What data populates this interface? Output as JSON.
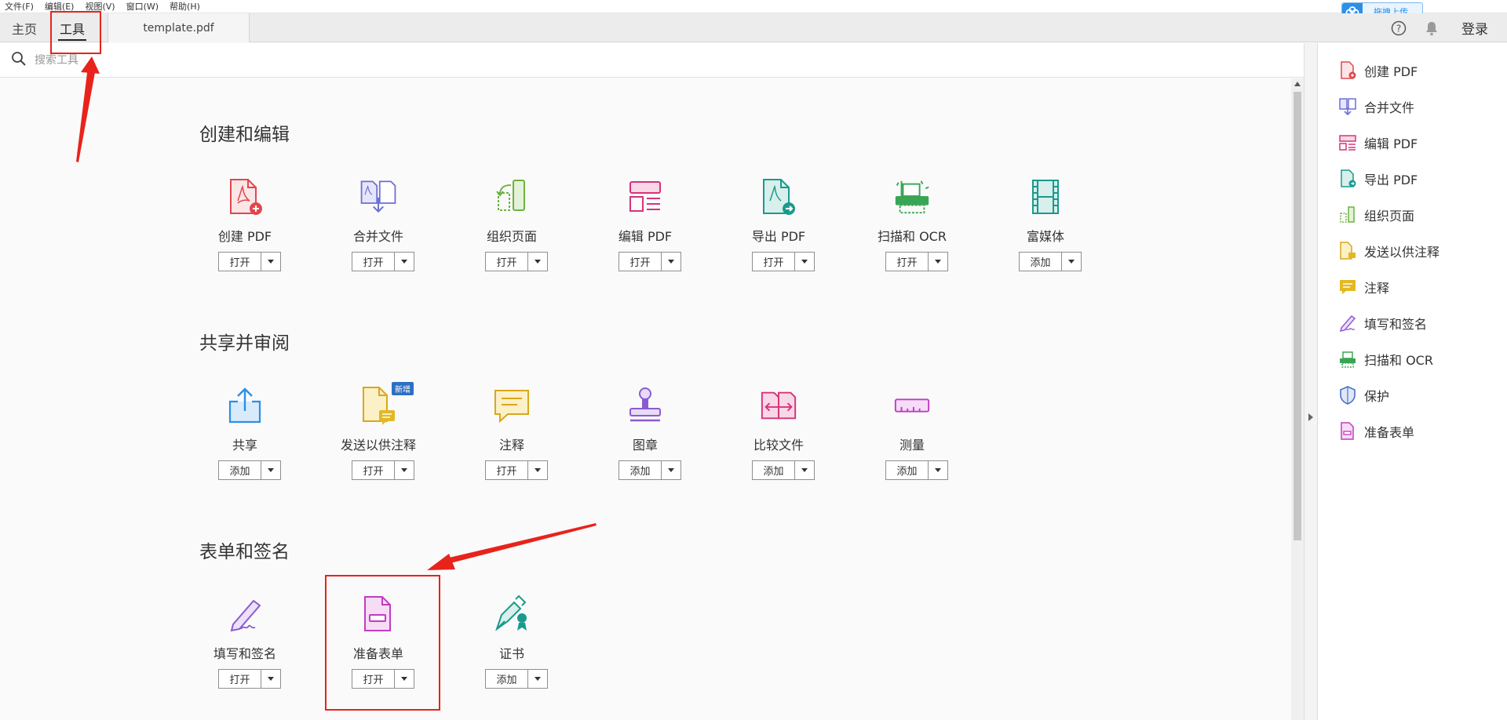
{
  "menu": [
    "文件(F)",
    "编辑(E)",
    "视图(V)",
    "窗口(W)",
    "帮助(H)"
  ],
  "tabs": {
    "home": "主页",
    "tools": "工具",
    "document": "template.pdf"
  },
  "topbar": {
    "login": "登录",
    "upload": "拖拽上传"
  },
  "search": {
    "placeholder": "搜索工具"
  },
  "sections": [
    {
      "title": "创建和编辑"
    },
    {
      "title": "共享并审阅"
    },
    {
      "title": "表单和签名"
    }
  ],
  "tools": {
    "create_pdf": {
      "name": "创建 PDF",
      "button": "打开"
    },
    "combine": {
      "name": "合并文件",
      "button": "打开"
    },
    "organize": {
      "name": "组织页面",
      "button": "打开"
    },
    "edit_pdf": {
      "name": "编辑 PDF",
      "button": "打开"
    },
    "export_pdf": {
      "name": "导出 PDF",
      "button": "打开"
    },
    "scan_ocr": {
      "name": "扫描和 OCR",
      "button": "打开"
    },
    "rich_media": {
      "name": "富媒体",
      "button": "添加"
    },
    "share": {
      "name": "共享",
      "button": "添加"
    },
    "send_comment": {
      "name": "发送以供注释",
      "button": "打开",
      "badge": "新增"
    },
    "comment": {
      "name": "注释",
      "button": "打开"
    },
    "stamp": {
      "name": "图章",
      "button": "添加"
    },
    "compare": {
      "name": "比较文件",
      "button": "添加"
    },
    "measure": {
      "name": "测量",
      "button": "添加"
    },
    "fill_sign": {
      "name": "填写和签名",
      "button": "打开"
    },
    "prepare_form": {
      "name": "准备表单",
      "button": "打开"
    },
    "certificates": {
      "name": "证书",
      "button": "添加"
    }
  },
  "right_panel": [
    "创建 PDF",
    "合并文件",
    "编辑 PDF",
    "导出 PDF",
    "组织页面",
    "发送以供注释",
    "注释",
    "填写和签名",
    "扫描和 OCR",
    "保护",
    "准备表单"
  ],
  "colors": {
    "red": "#e0474c",
    "blue_purple": "#6c6fd6",
    "green": "#6cb33f",
    "pink": "#d6337a",
    "teal": "#1a9a8c",
    "yellow": "#e3b823",
    "blue": "#2b8fe6",
    "purple": "#8b5bd1",
    "magenta": "#c03cc4",
    "annotation": "#e8231b"
  }
}
